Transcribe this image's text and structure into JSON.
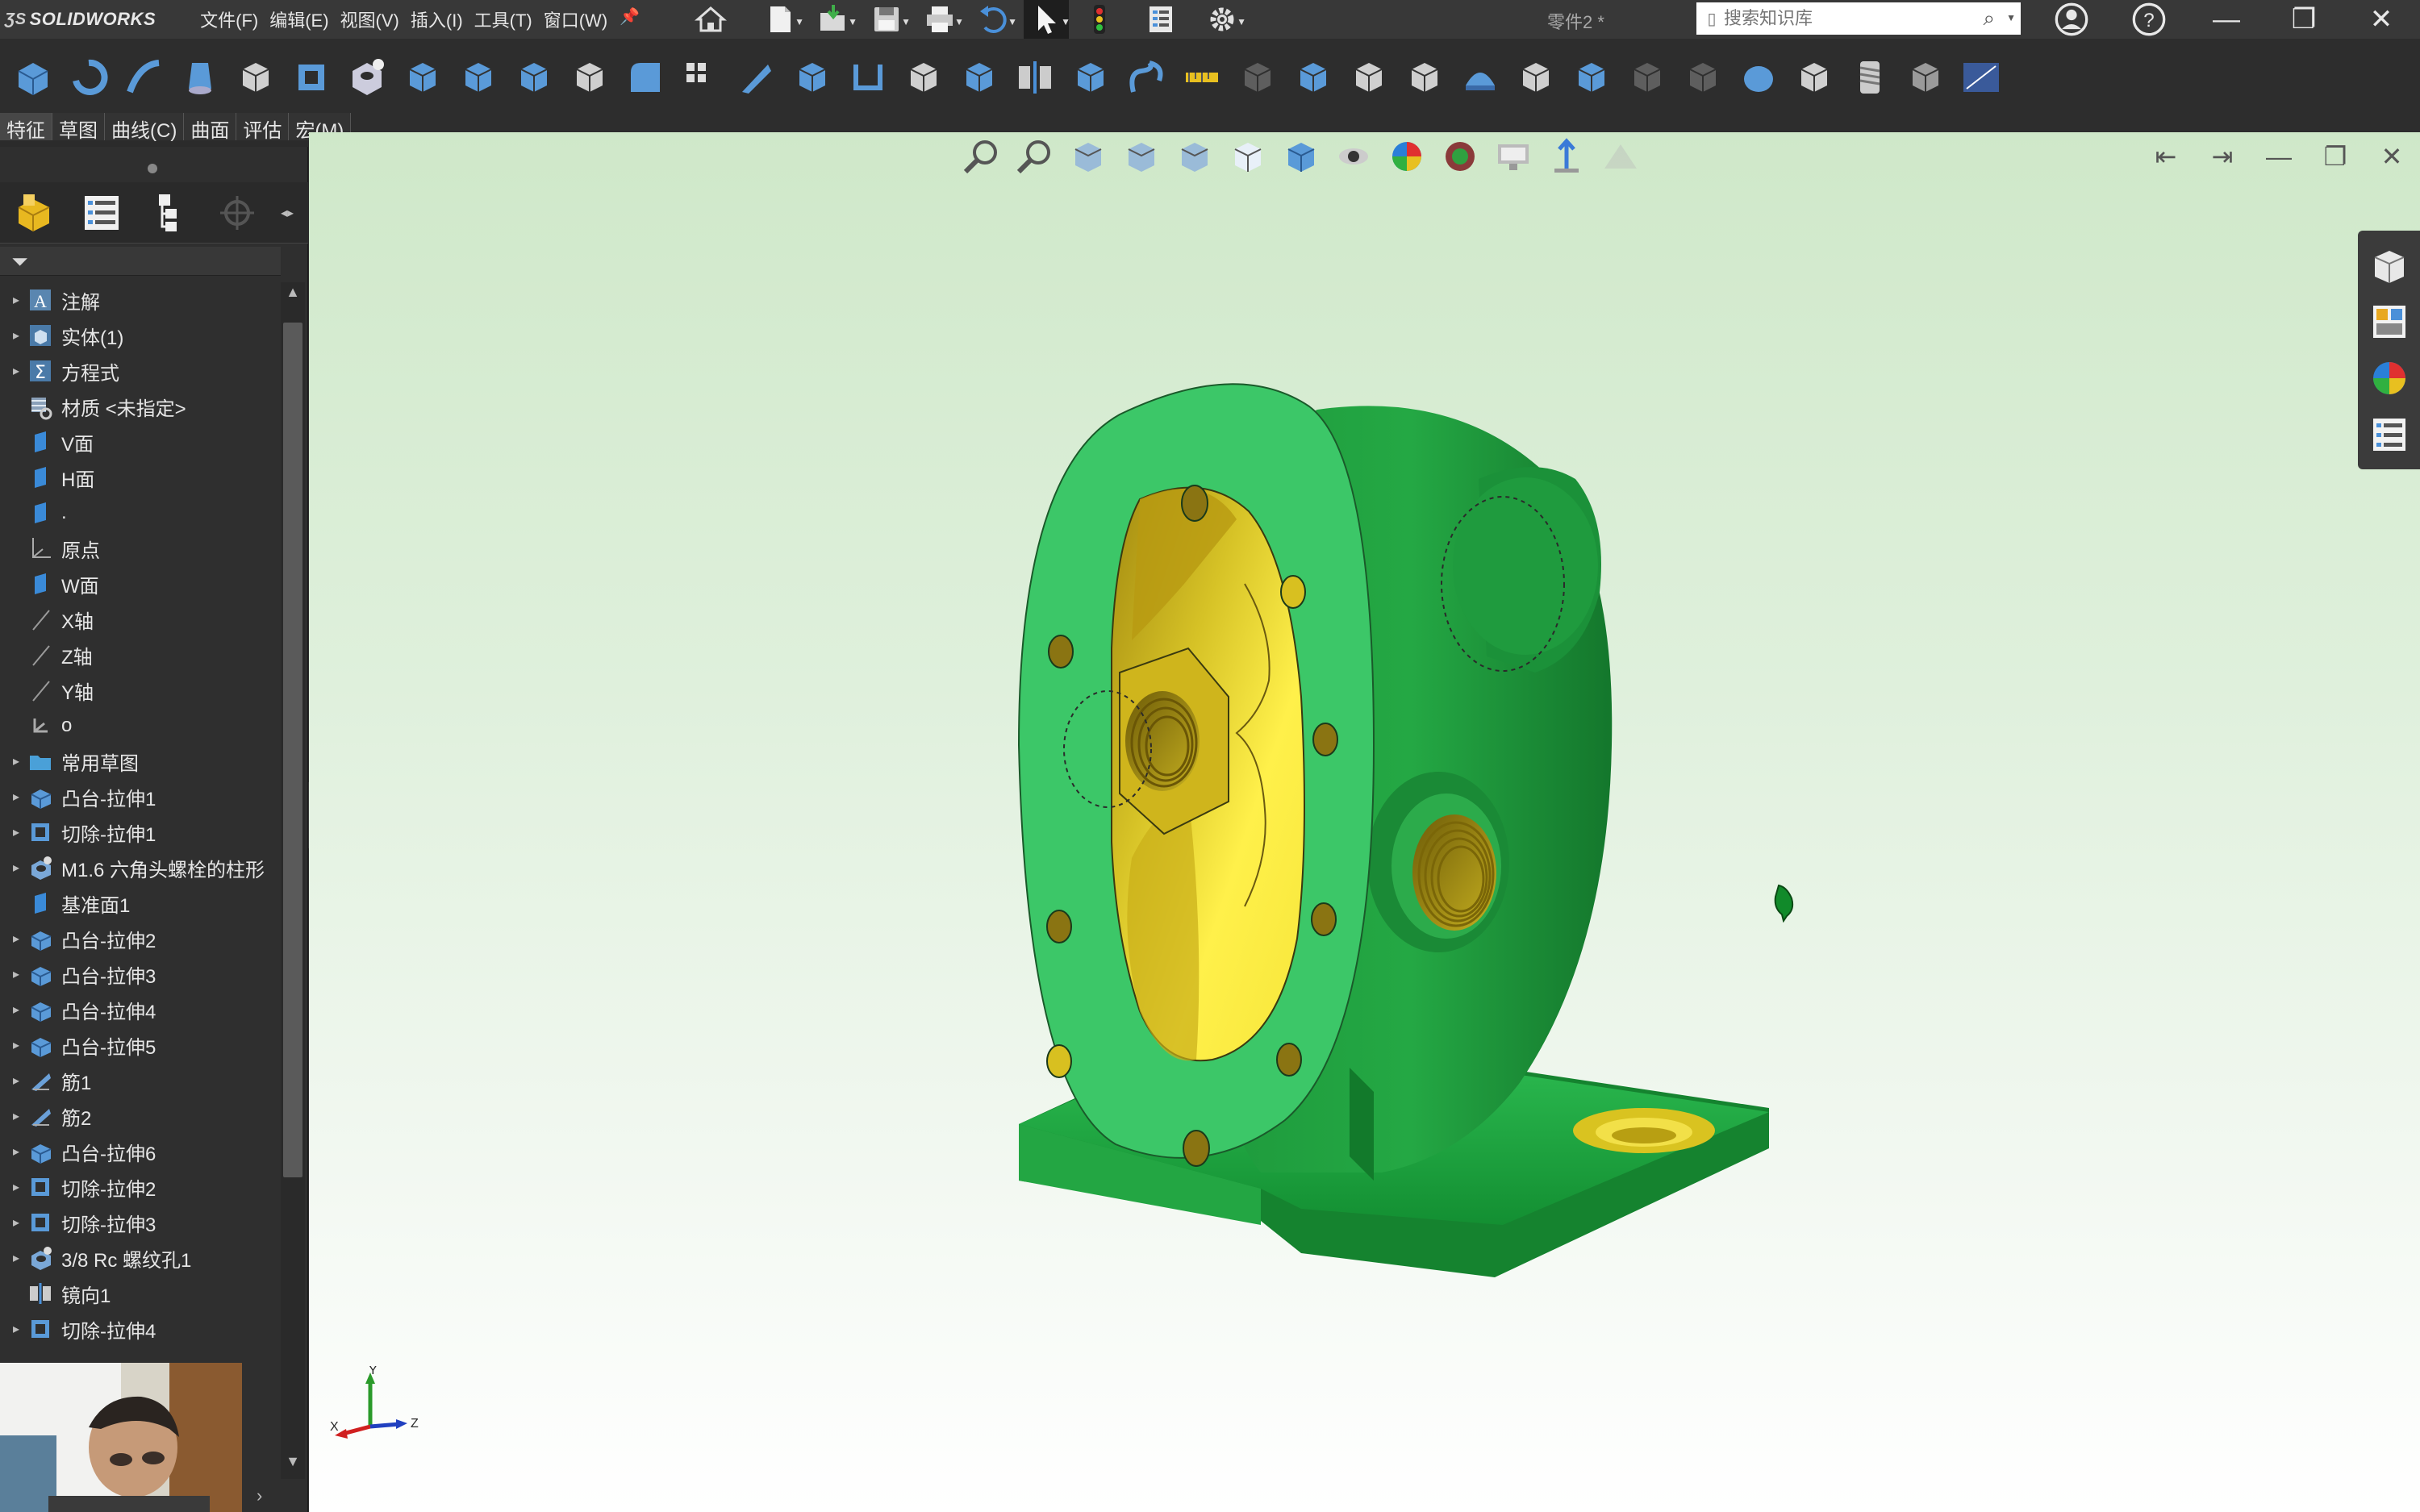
{
  "app": {
    "name": "SOLIDWORKS",
    "document_title": "零件2 *"
  },
  "menus": [
    "文件(F)",
    "编辑(E)",
    "视图(V)",
    "插入(I)",
    "工具(T)",
    "窗口(W)"
  ],
  "search": {
    "placeholder": "搜索知识库"
  },
  "command_tabs": [
    "特征",
    "草图",
    "曲线(C)",
    "曲面",
    "评估",
    "宏(M)"
  ],
  "active_command_tab": "特征",
  "feature_tree": [
    {
      "label": "注解",
      "icon": "annotations-icon",
      "expandable": true
    },
    {
      "label": "实体(1)",
      "icon": "solid-bodies-icon",
      "expandable": true
    },
    {
      "label": "方程式",
      "icon": "equations-icon",
      "expandable": true
    },
    {
      "label": "材质 <未指定>",
      "icon": "material-icon",
      "expandable": false
    },
    {
      "label": "V面",
      "icon": "plane-icon",
      "expandable": false
    },
    {
      "label": "H面",
      "icon": "plane-icon",
      "expandable": false
    },
    {
      "label": ".",
      "icon": "plane-icon",
      "expandable": false
    },
    {
      "label": "原点",
      "icon": "origin-icon",
      "expandable": false
    },
    {
      "label": "W面",
      "icon": "plane-icon",
      "expandable": false
    },
    {
      "label": "X轴",
      "icon": "axis-icon",
      "expandable": false
    },
    {
      "label": "Z轴",
      "icon": "axis-icon",
      "expandable": false
    },
    {
      "label": "Y轴",
      "icon": "axis-icon",
      "expandable": false
    },
    {
      "label": "o",
      "icon": "coordinate-system-icon",
      "expandable": false
    },
    {
      "label": "常用草图",
      "icon": "folder-icon",
      "expandable": true
    },
    {
      "label": "凸台-拉伸1",
      "icon": "boss-extrude-icon",
      "expandable": true
    },
    {
      "label": "切除-拉伸1",
      "icon": "cut-extrude-icon",
      "expandable": true
    },
    {
      "label": "M1.6 六角头螺栓的柱形",
      "icon": "hole-wizard-icon",
      "expandable": true
    },
    {
      "label": "基准面1",
      "icon": "plane-icon",
      "expandable": false
    },
    {
      "label": "凸台-拉伸2",
      "icon": "boss-extrude-icon",
      "expandable": true
    },
    {
      "label": "凸台-拉伸3",
      "icon": "boss-extrude-icon",
      "expandable": true
    },
    {
      "label": "凸台-拉伸4",
      "icon": "boss-extrude-icon",
      "expandable": true
    },
    {
      "label": "凸台-拉伸5",
      "icon": "boss-extrude-icon",
      "expandable": true
    },
    {
      "label": "筋1",
      "icon": "rib-icon",
      "expandable": true
    },
    {
      "label": "筋2",
      "icon": "rib-icon",
      "expandable": true
    },
    {
      "label": "凸台-拉伸6",
      "icon": "boss-extrude-icon",
      "expandable": true
    },
    {
      "label": "切除-拉伸2",
      "icon": "cut-extrude-icon",
      "expandable": true
    },
    {
      "label": "切除-拉伸3",
      "icon": "cut-extrude-icon",
      "expandable": true
    },
    {
      "label": "3/8 Rc 螺纹孔1",
      "icon": "hole-wizard-icon",
      "expandable": true
    },
    {
      "label": "镜向1",
      "icon": "mirror-icon",
      "expandable": false
    },
    {
      "label": "切除-拉伸4",
      "icon": "cut-extrude-icon",
      "expandable": true
    }
  ],
  "triad": {
    "x_label": "X",
    "y_label": "Y",
    "z_label": "Z"
  },
  "colors": {
    "body_green": "#2db84d",
    "flange_green": "#3cc768",
    "interior_yellow": "#e6d43a",
    "viewport_top": "#cfe8c9",
    "dark_ui": "#2d2d2d"
  }
}
